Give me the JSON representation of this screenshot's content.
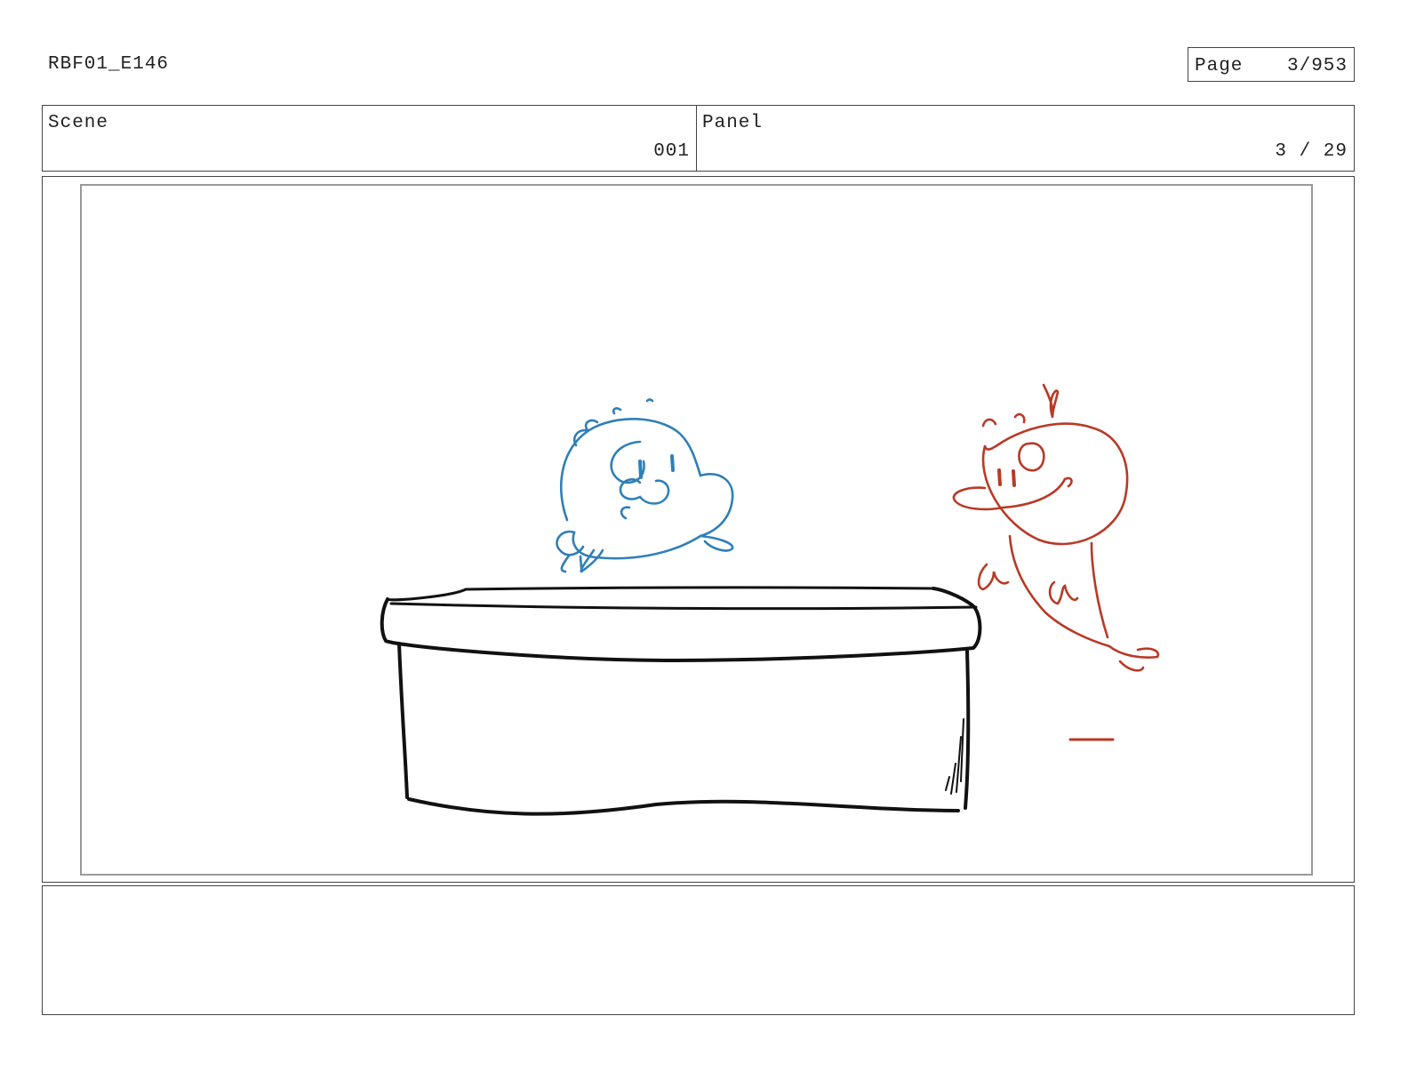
{
  "header": {
    "production_code": "RBF01_E146",
    "page_label": "Page",
    "page_value": "3/953"
  },
  "info": {
    "scene_label": "Scene",
    "scene_value": "001",
    "panel_label": "Panel",
    "panel_value": "3 / 29"
  },
  "drawing": {
    "blue_character_color": "#2f7fb8",
    "red_character_color": "#b83a26",
    "ink_color": "#111111"
  },
  "notes": {
    "text": ""
  }
}
